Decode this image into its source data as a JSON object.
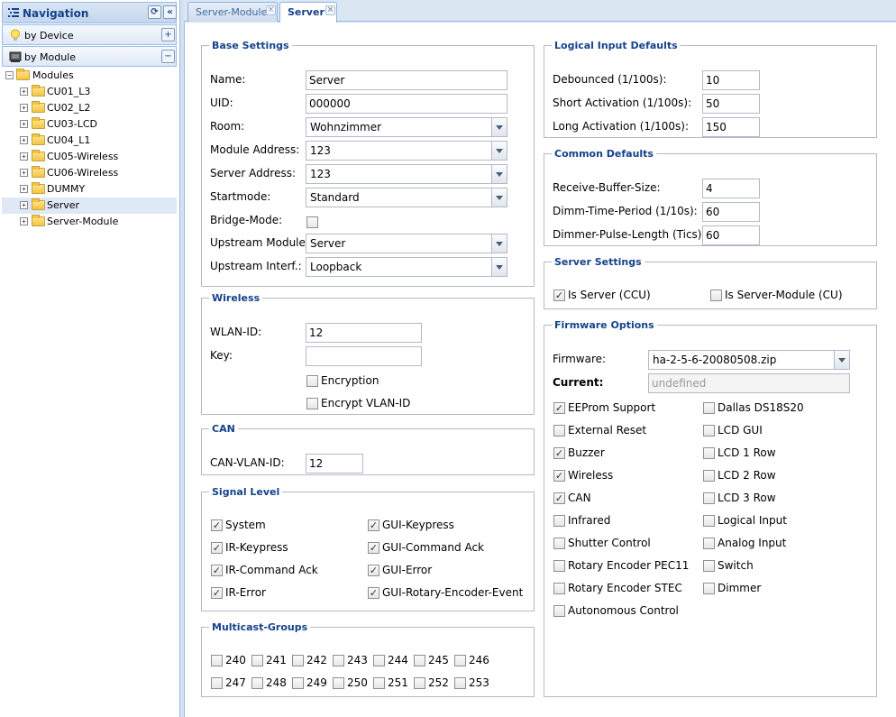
{
  "nav": {
    "title": "Navigation",
    "refresh_icon": "refresh-icon",
    "collapse_icon": "double-chevron-left-icon",
    "sections": [
      {
        "label": "by Device",
        "icon": "lightbulb-icon",
        "toggle": "+"
      },
      {
        "label": "by Module",
        "icon": "module-icon",
        "toggle": "−"
      }
    ],
    "tree": {
      "root": "Modules",
      "items": [
        "CU01_L3",
        "CU02_L2",
        "CU03-LCD",
        "CU04_L1",
        "CU05-Wireless",
        "CU06-Wireless",
        "DUMMY",
        "Server",
        "Server-Module"
      ],
      "selected": "Server"
    }
  },
  "tabs": [
    {
      "label": "Server-Module",
      "active": false
    },
    {
      "label": "Server",
      "active": true
    }
  ],
  "base": {
    "legend": "Base Settings",
    "name_label": "Name:",
    "name_value": "Server",
    "uid_label": "UID:",
    "uid_value": "000000",
    "room_label": "Room:",
    "room_value": "Wohnzimmer",
    "module_address_label": "Module Address:",
    "module_address_value": "123",
    "server_address_label": "Server Address:",
    "server_address_value": "123",
    "startmode_label": "Startmode:",
    "startmode_value": "Standard",
    "bridge_label": "Bridge-Mode:",
    "bridge_checked": false,
    "upstream_module_label": "Upstream Module:",
    "upstream_module_value": "Server",
    "upstream_interf_label": "Upstream Interf.:",
    "upstream_interf_value": "Loopback"
  },
  "wireless": {
    "legend": "Wireless",
    "wlan_label": "WLAN-ID:",
    "wlan_value": "12",
    "key_label": "Key:",
    "key_value": "",
    "encryption_label": "Encryption",
    "encryption_checked": false,
    "encrypt_vlan_label": "Encrypt VLAN-ID",
    "encrypt_vlan_checked": false
  },
  "can": {
    "legend": "CAN",
    "vlan_label": "CAN-VLAN-ID:",
    "vlan_value": "12"
  },
  "signal": {
    "legend": "Signal Level",
    "items": [
      {
        "label": "System",
        "checked": true
      },
      {
        "label": "GUI-Keypress",
        "checked": true
      },
      {
        "label": "IR-Keypress",
        "checked": true
      },
      {
        "label": "GUI-Command Ack",
        "checked": true
      },
      {
        "label": "IR-Command Ack",
        "checked": true
      },
      {
        "label": "GUI-Error",
        "checked": true
      },
      {
        "label": "IR-Error",
        "checked": true
      },
      {
        "label": "GUI-Rotary-Encoder-Event",
        "checked": true
      }
    ]
  },
  "multicast": {
    "legend": "Multicast-Groups",
    "items": [
      "240",
      "241",
      "242",
      "243",
      "244",
      "245",
      "246",
      "247",
      "248",
      "249",
      "250",
      "251",
      "252",
      "253"
    ]
  },
  "logical": {
    "legend": "Logical Input Defaults",
    "debounced_label": "Debounced (1/100s):",
    "debounced_value": "10",
    "short_label": "Short Activation (1/100s):",
    "short_value": "50",
    "long_label": "Long Activation (1/100s):",
    "long_value": "150"
  },
  "common": {
    "legend": "Common Defaults",
    "rbs_label": "Receive-Buffer-Size:",
    "rbs_value": "4",
    "dimm_label": "Dimm-Time-Period (1/10s):",
    "dimm_value": "60",
    "pulse_label": "Dimmer-Pulse-Length (Tics):",
    "pulse_value": "60"
  },
  "server_settings": {
    "legend": "Server Settings",
    "is_server_label": "Is Server (CCU)",
    "is_server_checked": true,
    "is_module_label": "Is Server-Module (CU)",
    "is_module_checked": false
  },
  "firmware": {
    "legend": "Firmware Options",
    "firmware_label": "Firmware:",
    "firmware_value": "ha-2-5-6-20080508.zip",
    "current_label": "Current:",
    "current_placeholder": "undefined",
    "left": [
      {
        "label": "EEProm Support",
        "checked": true
      },
      {
        "label": "External Reset",
        "checked": false
      },
      {
        "label": "Buzzer",
        "checked": true
      },
      {
        "label": "Wireless",
        "checked": true
      },
      {
        "label": "CAN",
        "checked": true
      },
      {
        "label": "Infrared",
        "checked": false
      },
      {
        "label": "Shutter Control",
        "checked": false
      },
      {
        "label": "Rotary Encoder PEC11",
        "checked": false
      },
      {
        "label": "Rotary Encoder STEC",
        "checked": false
      },
      {
        "label": "Autonomous Control",
        "checked": false
      }
    ],
    "right": [
      {
        "label": "Dallas DS18S20",
        "checked": false
      },
      {
        "label": "LCD GUI",
        "checked": false
      },
      {
        "label": "LCD 1 Row",
        "checked": false
      },
      {
        "label": "LCD 2 Row",
        "checked": false
      },
      {
        "label": "LCD 3 Row",
        "checked": false
      },
      {
        "label": "Logical Input",
        "checked": false
      },
      {
        "label": "Analog Input",
        "checked": false
      },
      {
        "label": "Switch",
        "checked": false
      },
      {
        "label": "Dimmer",
        "checked": false
      }
    ]
  }
}
